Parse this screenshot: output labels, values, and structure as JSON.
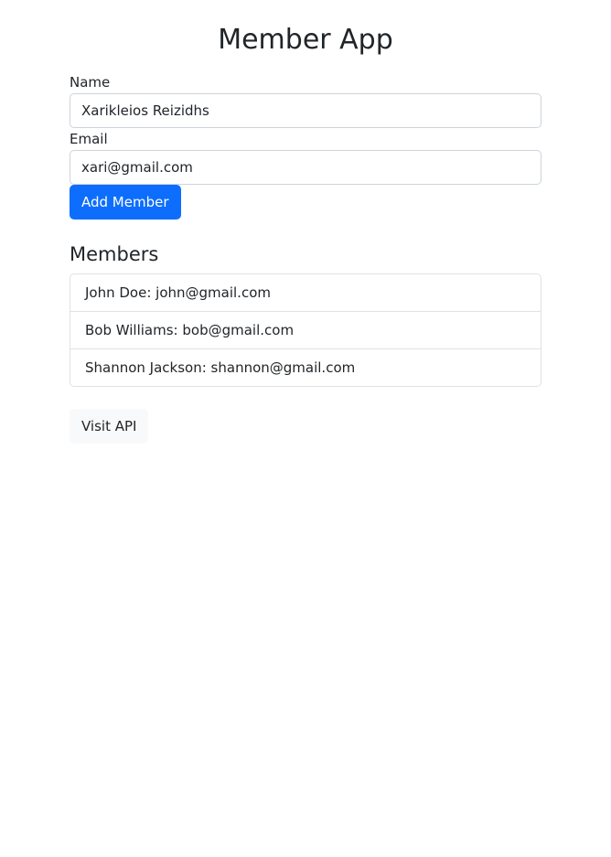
{
  "app": {
    "title": "Member App"
  },
  "form": {
    "name_label": "Name",
    "name_value": "Xarikleios Reizidhs",
    "email_label": "Email",
    "email_value": "xari@gmail.com",
    "submit_label": "Add Member"
  },
  "members": {
    "heading": "Members",
    "items": [
      "John Doe: john@gmail.com",
      "Bob Williams: bob@gmail.com",
      "Shannon Jackson: shannon@gmail.com"
    ]
  },
  "footer": {
    "api_link_label": "Visit API"
  },
  "colors": {
    "primary": "#0d6efd",
    "light": "#f8f9fa",
    "text": "#212529",
    "border": "#ced4da"
  }
}
